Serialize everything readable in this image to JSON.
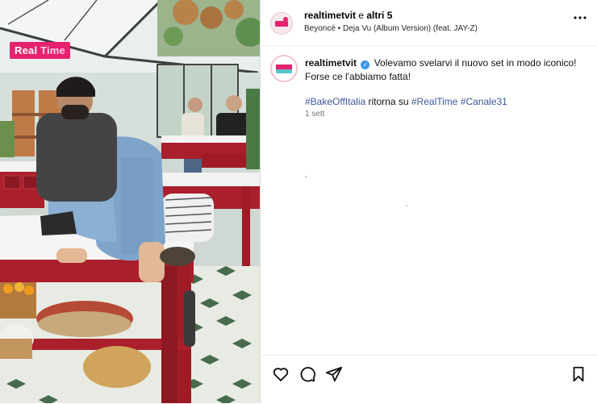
{
  "media": {
    "channel_badge_a": "Real",
    "channel_badge_b": "Time"
  },
  "header": {
    "username": "realtimetvit",
    "connector": " e ",
    "others": "altri 5",
    "song": "Beyoncé • Deja Vu (Album Version) (feat. JAY-Z)",
    "more_icon": "more-horizontal-icon"
  },
  "caption": {
    "username": "realtimetvit",
    "text_line1": "Volevamo svelarvi il nuovo set in modo iconico! Forse ce l'abbiamo fatta!",
    "hashtag_1": "#BakeOffItalia",
    "middle_text": " ritorna su ",
    "hashtag_2": "#RealTime",
    "hashtag_3": "#Canale31",
    "time": "1 sett"
  },
  "actions": {
    "like_icon": "heart-icon",
    "comment_icon": "comment-icon",
    "share_icon": "share-icon",
    "save_icon": "bookmark-icon"
  },
  "colors": {
    "brand_pink": "#e6216e",
    "link_blue": "#385898",
    "verified_blue": "#3897f0"
  }
}
